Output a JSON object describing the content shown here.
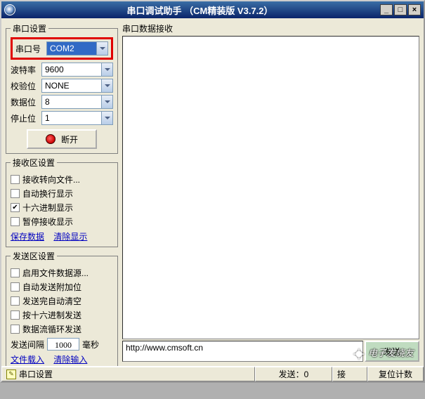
{
  "titlebar": {
    "title": "串口调试助手 （CM精装版 V3.7.2）"
  },
  "port_settings": {
    "legend": "串口设置",
    "port_label": "串口号",
    "port_value": "COM2",
    "baud_label": "波特率",
    "baud_value": "9600",
    "parity_label": "校验位",
    "parity_value": "NONE",
    "data_label": "数据位",
    "data_value": "8",
    "stop_label": "停止位",
    "stop_value": "1",
    "disconnect_label": "断开"
  },
  "recv_settings": {
    "legend": "接收区设置",
    "to_file": "接收转向文件...",
    "auto_wrap": "自动换行显示",
    "hex_display": "十六进制显示",
    "pause": "暂停接收显示",
    "save_link": "保存数据",
    "clear_link": "清除显示"
  },
  "send_settings": {
    "legend": "发送区设置",
    "file_source": "启用文件数据源...",
    "auto_append": "自动发送附加位",
    "auto_clear": "发送完自动清空",
    "hex_send": "按十六进制发送",
    "loop_send": "数据流循环发送",
    "interval_label": "发送间隔",
    "interval_value": "1000",
    "interval_unit": "毫秒",
    "load_file_link": "文件载入",
    "clear_input_link": "清除输入"
  },
  "recv_area": {
    "legend": "串口数据接收"
  },
  "send_area": {
    "input_text": "http://www.cmsoft.cn",
    "send_button": "发送"
  },
  "statusbar": {
    "main": "串口设置",
    "sent": "发送：0",
    "recv_prefix": "接",
    "reset": "复位计数"
  },
  "watermark": "电子发烧友"
}
